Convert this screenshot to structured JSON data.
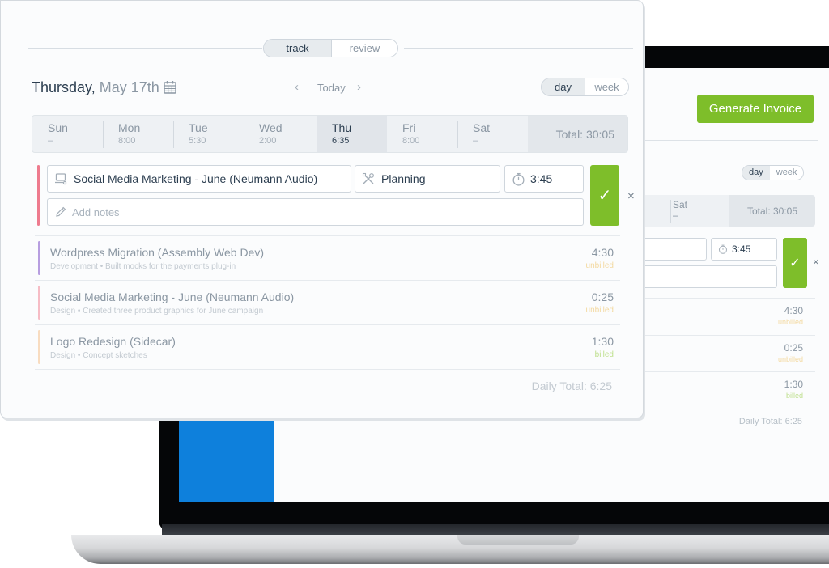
{
  "background_app": {
    "generate_invoice_label": "Generate Invoice",
    "view_toggle": {
      "day": "day",
      "week": "week"
    },
    "week": {
      "sat_label": "Sat",
      "sat_hours": "–",
      "total": "Total: 30:05"
    },
    "timer_value": "3:45",
    "save_icon": "✓",
    "cancel_icon": "×",
    "entries": [
      {
        "time": "4:30",
        "status": "unbilled"
      },
      {
        "time": "0:25",
        "status": "unbilled"
      },
      {
        "time": "1:30",
        "status": "billed"
      }
    ],
    "daily_total": "Daily Total: 6:25"
  },
  "card": {
    "mode_toggle": {
      "track": "track",
      "review": "review",
      "active": "track"
    },
    "date": {
      "weekday": "Thursday,",
      "date": "May 17th"
    },
    "nav": {
      "prev": "‹",
      "today": "Today",
      "next": "›"
    },
    "view_toggle": {
      "day": "day",
      "week": "week",
      "active": "day"
    },
    "week": {
      "days": [
        {
          "name": "Sun",
          "hours": "–"
        },
        {
          "name": "Mon",
          "hours": "8:00"
        },
        {
          "name": "Tue",
          "hours": "5:30"
        },
        {
          "name": "Wed",
          "hours": "2:00"
        },
        {
          "name": "Thu",
          "hours": "6:35"
        },
        {
          "name": "Fri",
          "hours": "8:00"
        },
        {
          "name": "Sat",
          "hours": "–"
        }
      ],
      "active_day": "Thu",
      "total": "Total: 30:05"
    },
    "new_entry": {
      "project": "Social Media Marketing - June (Neumann Audio)",
      "task": "Planning",
      "timer": "3:45",
      "notes_placeholder": "Add notes",
      "notes_value": "",
      "save_icon": "✓",
      "cancel_icon": "×",
      "color": "#ee7b8e"
    },
    "entries": [
      {
        "project": "Wordpress Migration (Assembly Web Dev)",
        "task": "Development",
        "sep": "•",
        "notes": "Built mocks for the payments plug-in",
        "time": "4:30",
        "status": "unbilled",
        "color": "#b79ee0"
      },
      {
        "project": "Social Media Marketing - June (Neumann Audio)",
        "task": "Design",
        "sep": "•",
        "notes": "Created three product graphics for June campaign",
        "time": "0:25",
        "status": "unbilled",
        "color": "#f6bcc5"
      },
      {
        "project": "Logo Redesign (Sidecar)",
        "task": "Design",
        "sep": "•",
        "notes": "Concept sketches",
        "time": "1:30",
        "status": "billed",
        "color": "#f8dcc0"
      }
    ],
    "daily_total": "Daily Total: 6:25"
  },
  "colors": {
    "accent_green": "#7ebe2a",
    "unbilled": "#f3d9a0",
    "billed": "#bfe08e",
    "laptop_sidebar_blue": "#0e80dc"
  }
}
